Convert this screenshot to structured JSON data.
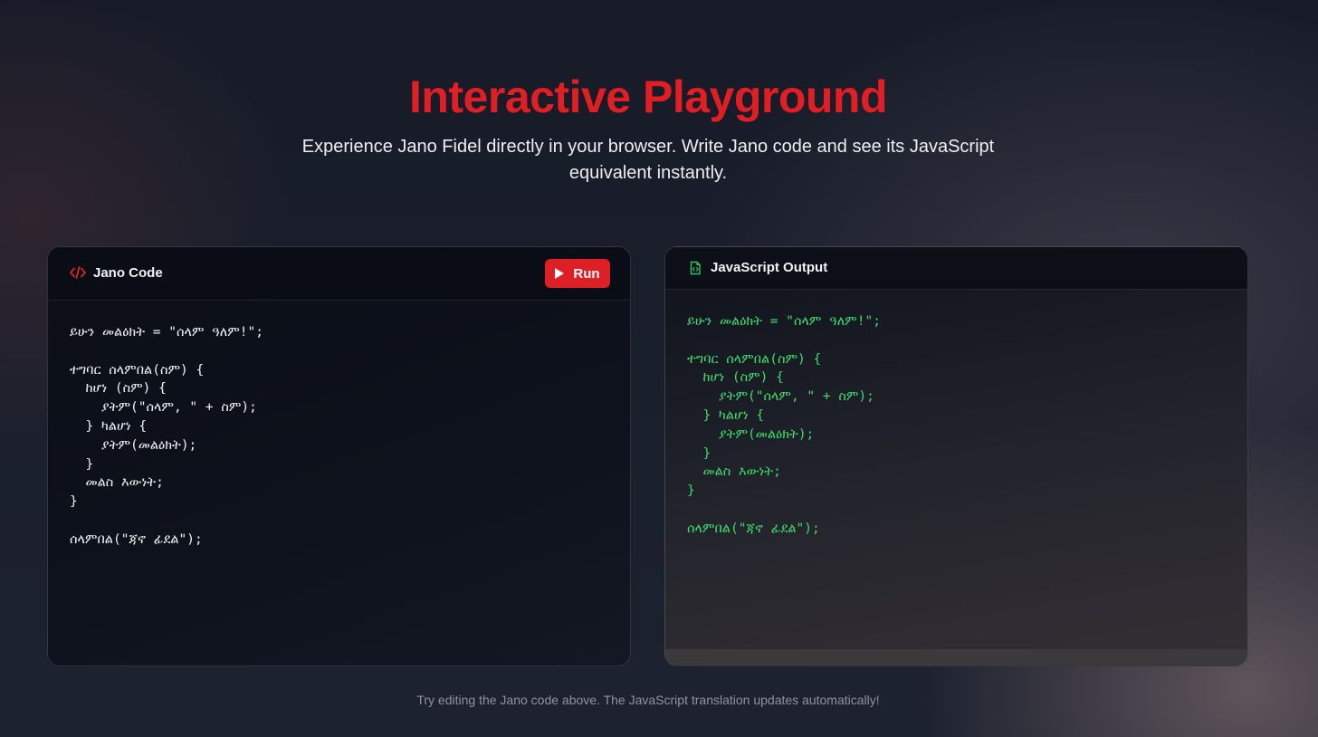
{
  "hero": {
    "title": "Interactive Playground",
    "subtitle": "Experience Jano Fidel directly in your browser. Write Jano code and see its JavaScript equivalent instantly."
  },
  "editor": {
    "title": "Jano Code",
    "icon": "code-brackets-icon",
    "run_label": "Run",
    "code": "ይሁን መልዕክት = \"ሰላም ዓለም!\";\n\nተግባር ሰላምበል(ስም) {\n  ከሆነ (ስም) {\n    ያትም(\"ሰላም, \" + ስም);\n  } ካልሆነ {\n    ያትም(መልዕክት);\n  }\n  መልስ እውነት;\n}\n\nሰላምበል(\"ጃኖ ፊደል\");"
  },
  "output": {
    "title": "JavaScript Output",
    "icon": "file-code-icon",
    "code": "ይሁን መልዕክት = \"ሰላም ዓለም!\";\n\nተግባር ሰላምበል(ስም) {\n  ከሆነ (ስም) {\n    ያትም(\"ሰላም, \" + ስም);\n  } ካልሆነ {\n    ያትም(መልዕክት);\n  }\n  መልስ እውነት;\n}\n\nሰላምበል(\"ጃኖ ፊደል\");"
  },
  "footer": {
    "note": "Try editing the Jano code above. The JavaScript translation updates automatically!"
  },
  "colors": {
    "accent": "#dc2026",
    "title": "#e01e24",
    "output_code": "#3ddc6b",
    "output_icon": "#2fc55e"
  }
}
